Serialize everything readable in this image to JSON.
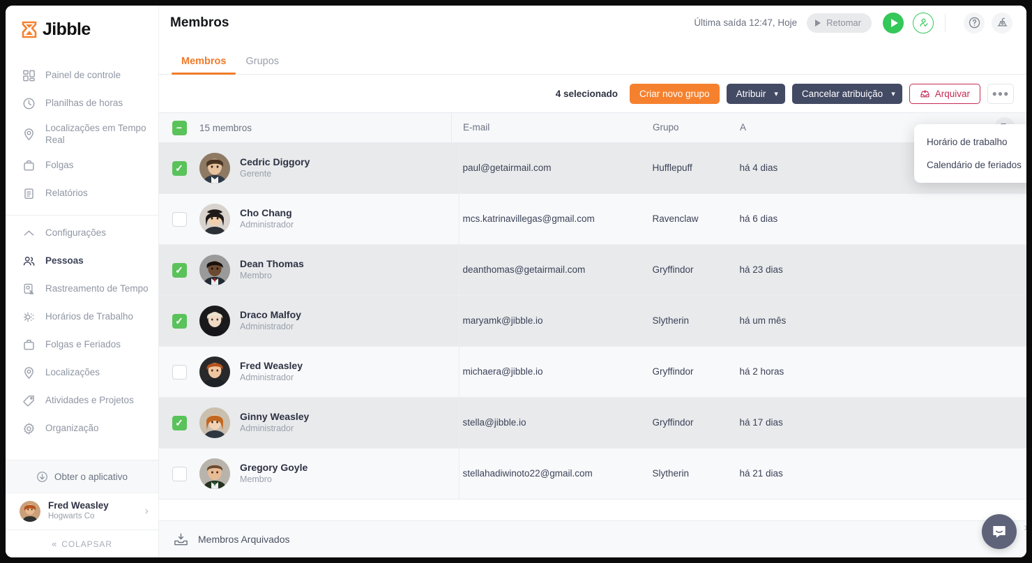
{
  "brand": {
    "name": "Jibble",
    "orange": "#f5812f",
    "dark": "#434a63",
    "green": "#34c759",
    "crimson": "#c62a54"
  },
  "sidebar": {
    "items": [
      {
        "label": "Painel de controle",
        "icon": "dashboard-icon",
        "active": false
      },
      {
        "label": "Planilhas de horas",
        "icon": "clock-icon",
        "active": false
      },
      {
        "label": "Localizações em Tempo Real",
        "icon": "pin-icon",
        "active": false
      },
      {
        "label": "Folgas",
        "icon": "briefcase-icon",
        "active": false
      },
      {
        "label": "Relatórios",
        "icon": "clipboard-icon",
        "active": false
      }
    ],
    "settings_items": [
      {
        "label": "Configurações",
        "icon": "chevron-up-icon",
        "active": false
      },
      {
        "label": "Pessoas",
        "icon": "people-icon",
        "active": true
      },
      {
        "label": "Rastreamento de Tempo",
        "icon": "time-tracking-icon",
        "active": false
      },
      {
        "label": "Horários de Trabalho",
        "icon": "schedule-icon",
        "active": false
      },
      {
        "label": "Folgas e Feriados",
        "icon": "briefcase-icon",
        "active": false
      },
      {
        "label": "Localizações",
        "icon": "pin-icon",
        "active": false
      },
      {
        "label": "Atividades e Projetos",
        "icon": "tag-icon",
        "active": false
      },
      {
        "label": "Organização",
        "icon": "gear-icon",
        "active": false
      }
    ],
    "get_app": {
      "label": "Obter o aplicativo",
      "icon": "download-icon"
    },
    "user": {
      "name": "Fred Weasley",
      "org": "Hogwarts Co",
      "chevron": "chevron-right-icon"
    },
    "collapse": {
      "label": "COLAPSAR",
      "icon": "double-chevron-left-icon"
    }
  },
  "header": {
    "title": "Membros",
    "last_out": "Última saída 12:47, Hoje",
    "resume_button": "Retomar",
    "play_icon": "play-icon",
    "person_status_icon": "person-check-icon",
    "help_icon": "help-circle-icon",
    "whats_new_icon": "announcement-icon"
  },
  "tabs": [
    {
      "label": "Membros",
      "active": true
    },
    {
      "label": "Grupos",
      "active": false
    }
  ],
  "toolbar": {
    "selected_count": "4 selecionado",
    "create_group": "Criar novo grupo",
    "assign": "Atribuir",
    "unassign": "Cancelar atribuição",
    "archive": "Arquivar",
    "archive_icon": "archive-icon",
    "more_icon": "ellipsis-icon",
    "chevron": "chevron-down-icon"
  },
  "dropdown": {
    "items": [
      {
        "label": "Horário de trabalho"
      },
      {
        "label": "Calendário de feriados"
      }
    ]
  },
  "table": {
    "header_checkbox_state": "indeterminate",
    "count_label": "15 membros",
    "columns": [
      "E-mail",
      "Grupo",
      "A"
    ],
    "add_column_icon": "add-column-icon",
    "rows": [
      {
        "name": "Cedric Diggory",
        "role": "Gerente",
        "email": "paul@getairmail.com",
        "group": "Hufflepuff",
        "activity": "há 4 dias",
        "selected": true,
        "avatar": "cedric"
      },
      {
        "name": "Cho Chang",
        "role": "Administrador",
        "email": "mcs.katrinavillegas@gmail.com",
        "group": "Ravenclaw",
        "activity": "há 6 dias",
        "selected": false,
        "avatar": "cho"
      },
      {
        "name": "Dean Thomas",
        "role": "Membro",
        "email": "deanthomas@getairmail.com",
        "group": "Gryffindor",
        "activity": "há 23 dias",
        "selected": true,
        "avatar": "dean"
      },
      {
        "name": "Draco Malfoy",
        "role": "Administrador",
        "email": "maryamk@jibble.io",
        "group": "Slytherin",
        "activity": "há um mês",
        "selected": true,
        "avatar": "draco"
      },
      {
        "name": "Fred Weasley",
        "role": "Administrador",
        "email": "michaera@jibble.io",
        "group": "Gryffindor",
        "activity": "há 2 horas",
        "selected": false,
        "avatar": "fred"
      },
      {
        "name": "Ginny Weasley",
        "role": "Administrador",
        "email": "stella@jibble.io",
        "group": "Gryffindor",
        "activity": "há 17 dias",
        "selected": true,
        "avatar": "ginny"
      },
      {
        "name": "Gregory Goyle",
        "role": "Membro",
        "email": "stellahadiwinoto22@gmail.com",
        "group": "Slytherin",
        "activity": "há 21 dias",
        "selected": false,
        "avatar": "gregory"
      }
    ]
  },
  "footer": {
    "label": "Membros Arquivados",
    "icon": "archive-inbox-icon"
  },
  "chat": {
    "icon": "chat-bubble-icon"
  },
  "edge": {
    "icon": "chevron-right-icon"
  }
}
